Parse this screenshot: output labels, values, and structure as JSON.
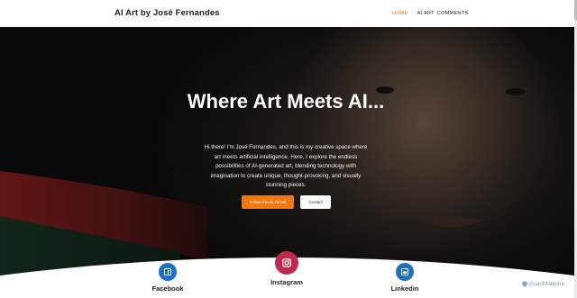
{
  "header": {
    "site_title": "AI Art by José Fernandes",
    "nav": [
      {
        "label": "HOME",
        "active": true
      },
      {
        "label": "AI ART",
        "active": false
      },
      {
        "label": "COMMENTS",
        "active": false
      }
    ]
  },
  "hero": {
    "title": "Where Art Meets AI...",
    "description": "Hi there! I'm José Fernandes, and this is my creative space where art meets artificial intelligence. Here, I explore the endless possibilities of AI-generated art, blending technology with imagination to create unique, thought-provoking, and visually stunning pieces.",
    "primary_button": "Follow me on TikTok",
    "secondary_button": "Contact"
  },
  "socials": [
    {
      "label": "Facebook",
      "icon": "facebook-icon",
      "color": "#1f6fc2"
    },
    {
      "label": "Instagram",
      "icon": "instagram-icon",
      "color": "#c0294f"
    },
    {
      "label": "Linkedin",
      "icon": "linkedin-icon",
      "color": "#1f6fc2"
    }
  ],
  "watermark": "ScanMalware",
  "colors": {
    "accent": "#e8760c",
    "tiktok_button": "#f07a12"
  }
}
